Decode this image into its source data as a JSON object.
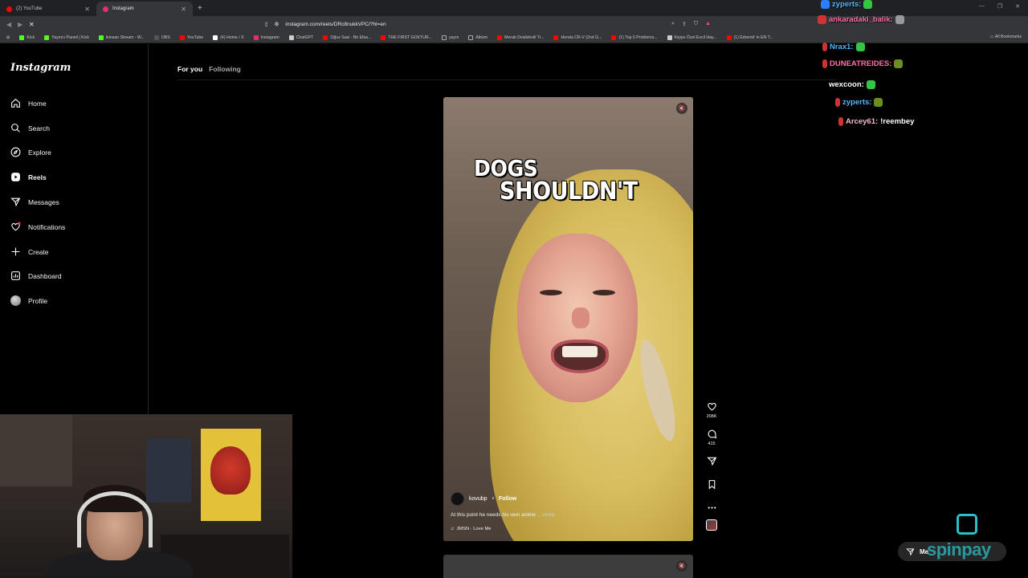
{
  "browser": {
    "tabs": [
      {
        "title": "(2) YouTube",
        "active": false,
        "color": "#ff0000"
      },
      {
        "title": "Instagram",
        "active": true,
        "color": "#e1306c"
      }
    ],
    "url": "instagram.com/reels/DRc8nukkVPC/?hl=en",
    "bookmarks": [
      {
        "label": "Kick",
        "color": "#53fc18"
      },
      {
        "label": "Yayıncı Paneli | Kick",
        "color": "#53fc18"
      },
      {
        "label": "ikinsan Stream - W...",
        "color": "#53fc18"
      },
      {
        "label": "OBS",
        "color": "#555555"
      },
      {
        "label": "YouTube",
        "color": "#ff0000"
      },
      {
        "label": "(4) Home / X",
        "color": "#ffffff"
      },
      {
        "label": "Instagram",
        "color": "#e1306c"
      },
      {
        "label": "ChatGPT",
        "color": "#cccccc"
      },
      {
        "label": "Oğuz Sasi - Bir Efsa...",
        "color": "#ff0000"
      },
      {
        "label": "THE FIRST GOKTUR...",
        "color": "#ff0000"
      },
      {
        "label": "yayın",
        "color": "#888888"
      },
      {
        "label": "Albüm",
        "color": "#888888"
      },
      {
        "label": "Merab Dvalishvili Tr...",
        "color": "#ff0000"
      },
      {
        "label": "Honda CR-V (2nd G...",
        "color": "#ff0000"
      },
      {
        "label": "(1) Top 5 Problems...",
        "color": "#ff0000"
      },
      {
        "label": "Kişiye Özel Evcil Hay...",
        "color": "#cccccc"
      },
      {
        "label": "(1) Edremit' in EN T...",
        "color": "#ff0000"
      }
    ],
    "all_bookmarks": "All Bookmarks"
  },
  "sidebar": {
    "logo": "Instagram",
    "items": [
      {
        "label": "Home",
        "icon": "home-icon"
      },
      {
        "label": "Search",
        "icon": "search-icon"
      },
      {
        "label": "Explore",
        "icon": "compass-icon"
      },
      {
        "label": "Reels",
        "icon": "reels-icon",
        "active": true
      },
      {
        "label": "Messages",
        "icon": "messenger-icon"
      },
      {
        "label": "Notifications",
        "icon": "heart-icon"
      },
      {
        "label": "Create",
        "icon": "plus-icon"
      },
      {
        "label": "Dashboard",
        "icon": "dashboard-icon"
      },
      {
        "label": "Profile",
        "icon": "avatar"
      }
    ]
  },
  "feed": {
    "tabs": {
      "for_you": "For you",
      "following": "Following"
    }
  },
  "reel": {
    "overlay_line1": "DOGS",
    "overlay_line2": "SHOULDN'T",
    "author": "kovubp",
    "separator": "•",
    "follow": "Follow",
    "caption": "At this point he needs his own anime",
    "more": "... more",
    "audio": "JMSN · Love Me",
    "likes": "208K",
    "comments": "415"
  },
  "messages_pill": {
    "label": "Me"
  },
  "stream": {
    "chat": [
      {
        "user": "zyperts:",
        "color": "#4db8ff"
      },
      {
        "user": "ankaradaki_balik:",
        "color": "#ff6fa8"
      },
      {
        "user": "Nrax1:",
        "color": "#4db8ff"
      },
      {
        "user": "DUNEATREIDES:",
        "color": "#ff6fa8"
      },
      {
        "user": "wexcoon:",
        "color": "#ffffff"
      },
      {
        "user": "zyperts:",
        "color": "#4db8ff"
      },
      {
        "user": "Arcey61:",
        "color": "#f4b8c8",
        "message": "!reembey"
      }
    ],
    "sponsor": "spinpay"
  }
}
